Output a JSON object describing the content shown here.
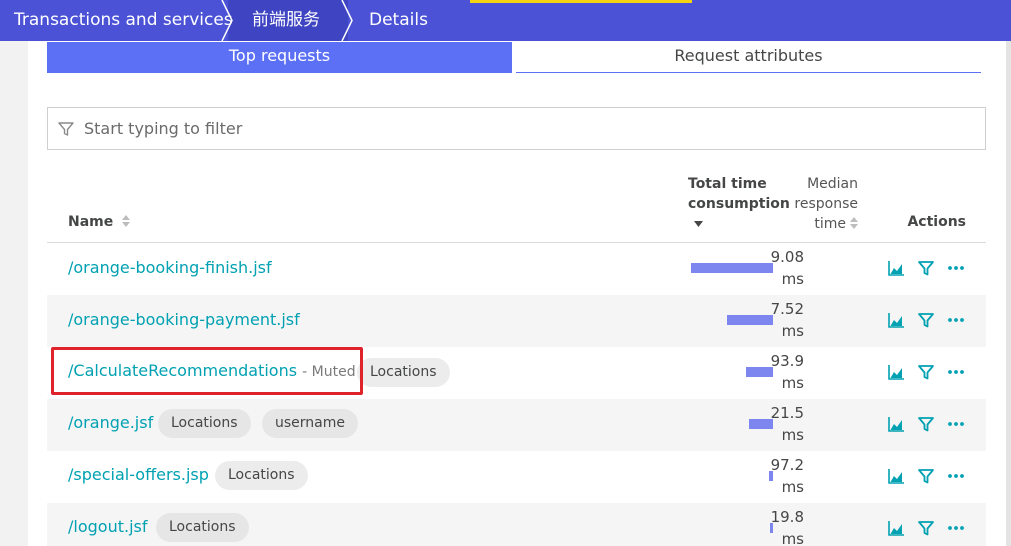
{
  "breadcrumb": {
    "items": [
      "Transactions and services",
      "前端服务",
      "Details"
    ]
  },
  "tabs": [
    {
      "label": "Top requests",
      "active": true
    },
    {
      "label": "Request attributes",
      "active": false
    }
  ],
  "filter": {
    "placeholder": "Start typing to filter"
  },
  "table": {
    "headers": {
      "name": "Name",
      "total_line1": "Total time",
      "total_line2": "consumption",
      "median_line1": "Median",
      "median_line2": "response",
      "median_line3": "time",
      "actions": "Actions"
    },
    "rows": [
      {
        "name": "/orange-booking-finish.jsf",
        "muted": "",
        "tags": [],
        "bar": 0.82,
        "median_value": "9.08",
        "median_unit": "ms"
      },
      {
        "name": "/orange-booking-payment.jsf",
        "muted": "",
        "tags": [],
        "bar": 0.46,
        "median_value": "7.52",
        "median_unit": "ms"
      },
      {
        "name": "/CalculateRecommendations",
        "muted": "- Muted",
        "tags": [
          "Locations"
        ],
        "bar": 0.27,
        "median_value": "93.9",
        "median_unit": "ms"
      },
      {
        "name": "/orange.jsf",
        "muted": "",
        "tags": [
          "Locations",
          "username"
        ],
        "bar": 0.24,
        "median_value": "21.5",
        "median_unit": "ms"
      },
      {
        "name": "/special-offers.jsp",
        "muted": "",
        "tags": [
          "Locations"
        ],
        "bar": 0.04,
        "median_value": "97.2",
        "median_unit": "ms"
      },
      {
        "name": "/logout.jsf",
        "muted": "",
        "tags": [
          "Locations"
        ],
        "bar": 0.03,
        "median_value": "19.8",
        "median_unit": "ms"
      }
    ]
  },
  "icons": {
    "chart": "area-chart-icon",
    "filter": "filter-icon",
    "more": "more-icon"
  },
  "colors": {
    "header": "#4b52d6",
    "accent": "#5b70f5",
    "link": "#00a1b2",
    "bar": "#7c86ee",
    "highlight": "#e0232a"
  }
}
